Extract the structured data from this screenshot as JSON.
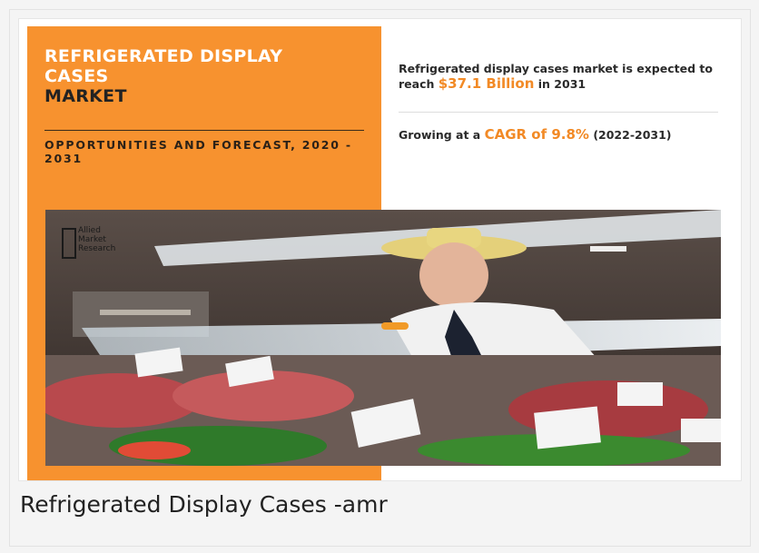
{
  "infographic": {
    "title_line1": "REFRIGERATED DISPLAY",
    "title_line2": "CASES",
    "title_line3": "MARKET",
    "subtitle": "OPPORTUNITIES AND FORECAST, 2020 - 2031",
    "stat1_prefix": "Refrigerated display cases market is expected to reach",
    "stat1_value": "$37.1 Billion",
    "stat1_suffix": "in 2031",
    "stat2_prefix": "Growing at a",
    "stat2_value": "CAGR of 9.8%",
    "stat2_suffix": "(2022-2031)",
    "logo_lines": [
      "Allied",
      "Market",
      "Research"
    ]
  },
  "caption": "Refrigerated Display Cases -amr",
  "colors": {
    "accent_orange": "#f7922f",
    "highlight_orange": "#f28a26",
    "text_dark": "#222222"
  },
  "icons": [
    "allied-market-research-logo"
  ]
}
